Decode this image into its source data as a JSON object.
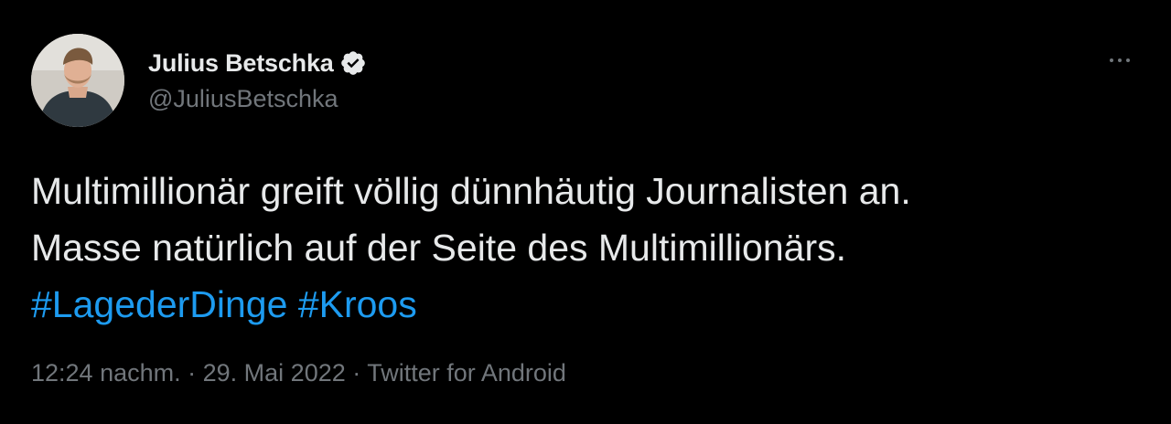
{
  "author": {
    "display_name": "Julius Betschka",
    "handle": "@JuliusBetschka",
    "verified": true
  },
  "more_icon": "more-horizontal-icon",
  "tweet": {
    "line1": "Multimillionär greift völlig dünnhäutig Journalisten an.",
    "line2": "Masse natürlich auf der Seite des Multimillionärs.",
    "hashtags": [
      "#LagederDinge",
      "#Kroos"
    ]
  },
  "meta": {
    "time": "12:24 nachm.",
    "separator": "·",
    "date": "29. Mai 2022",
    "source": "Twitter for Android"
  },
  "colors": {
    "background": "#000000",
    "text": "#e7e9ea",
    "secondary": "#71767b",
    "accent": "#1d9bf0"
  }
}
